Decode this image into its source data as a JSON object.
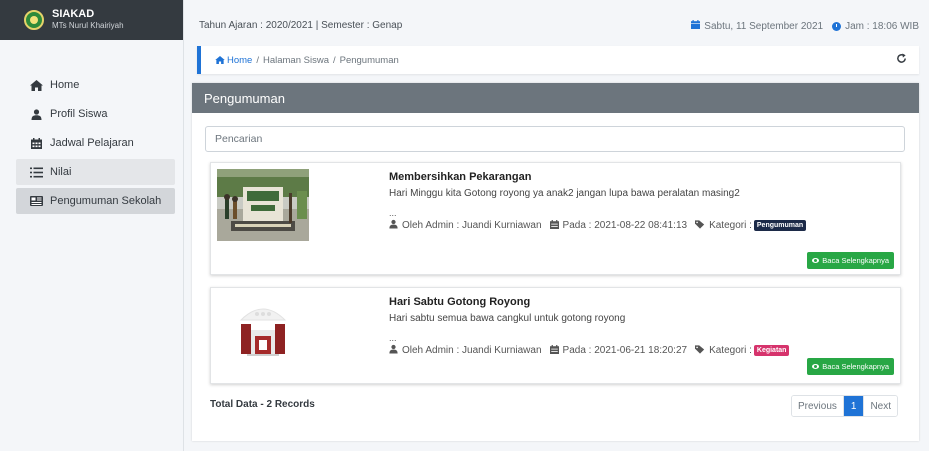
{
  "brand": {
    "title": "SIAKAD",
    "subtitle": "MTs Nurul Khairiyah"
  },
  "sidebar": {
    "items": [
      {
        "label": "Home",
        "icon": "home-icon"
      },
      {
        "label": "Profil Siswa",
        "icon": "user-icon"
      },
      {
        "label": "Jadwal Pelajaran",
        "icon": "calendar-icon"
      },
      {
        "label": "Nilai",
        "icon": "list-icon"
      },
      {
        "label": "Pengumuman Sekolah",
        "icon": "newspaper-icon"
      }
    ]
  },
  "topbar": {
    "session": "Tahun Ajaran : 2020/2021 | Semester : Genap",
    "date": "Sabtu, 11 September 2021",
    "time": "Jam : 18:06 WIB"
  },
  "breadcrumb": {
    "home": "Home",
    "sep1": "/",
    "level1": "Halaman Siswa",
    "sep2": "/",
    "level2": "Pengumuman"
  },
  "card": {
    "title": "Pengumuman"
  },
  "search": {
    "placeholder": "Pencarian"
  },
  "posts": [
    {
      "title": "Membersihkan Pekarangan",
      "desc": "Hari Minggu kita Gotong royong ya anak2 jangan lupa bawa peralatan masing2",
      "ellipsis": "...",
      "author": "Oleh Admin : Juandi Kurniawan",
      "date": "Pada : 2021-08-22 08:41:13",
      "category_label": "Kategori :",
      "category": "Pengumuman",
      "read_more": "Baca Selengkapnya"
    },
    {
      "title": "Hari Sabtu Gotong Royong",
      "desc": "Hari sabtu semua bawa cangkul untuk gotong royong",
      "ellipsis": "...",
      "author": "Oleh Admin : Juandi Kurniawan",
      "date": "Pada : 2021-06-21 18:20:27",
      "category_label": "Kategori :",
      "category": "Kegiatan",
      "read_more": "Baca Selengkapnya"
    }
  ],
  "footer": {
    "total": "Total Data - 2 Records"
  },
  "pagination": {
    "prev": "Previous",
    "current": "1",
    "next": "Next"
  },
  "colors": {
    "primary": "#1f73d6",
    "success": "#28a745",
    "header": "#6c757d",
    "badge_dark": "#1c2a48",
    "badge_red": "#d6336c"
  }
}
